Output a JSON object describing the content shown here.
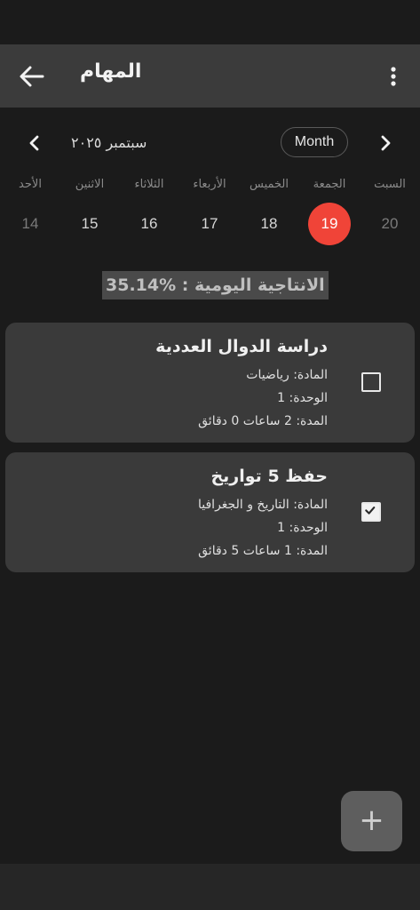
{
  "app_bar": {
    "title": "المهام",
    "back_icon": "arrow-left-icon",
    "menu_icon": "more-vert-icon"
  },
  "calendar": {
    "month_label": "سبتمبر ٢٠٢٥",
    "view_toggle": "Month",
    "weekdays": [
      "الأحد",
      "الاثنين",
      "الثلاثاء",
      "الأربعاء",
      "الخميس",
      "الجمعة",
      "السبت"
    ],
    "days": [
      "14",
      "15",
      "16",
      "17",
      "18",
      "19",
      "20"
    ],
    "selected_day": "19",
    "accent_color": "#f04438"
  },
  "productivity": "الانتاجية اليومية : %35.14",
  "tasks": [
    {
      "title": "دراسة الدوال العددية",
      "subject": "المادة: رياضيات",
      "unit": "الوحدة: 1",
      "duration": "المدة: 2 ساعات 0 دقائق",
      "done": false
    },
    {
      "title": "حفظ 5 تواريخ",
      "subject": "المادة: التاريخ و الجغرافيا",
      "unit": "الوحدة: 1",
      "duration": "المدة: 1 ساعات 5 دقائق",
      "done": true
    }
  ],
  "fab": {
    "label": "+",
    "icon": "plus-icon"
  }
}
